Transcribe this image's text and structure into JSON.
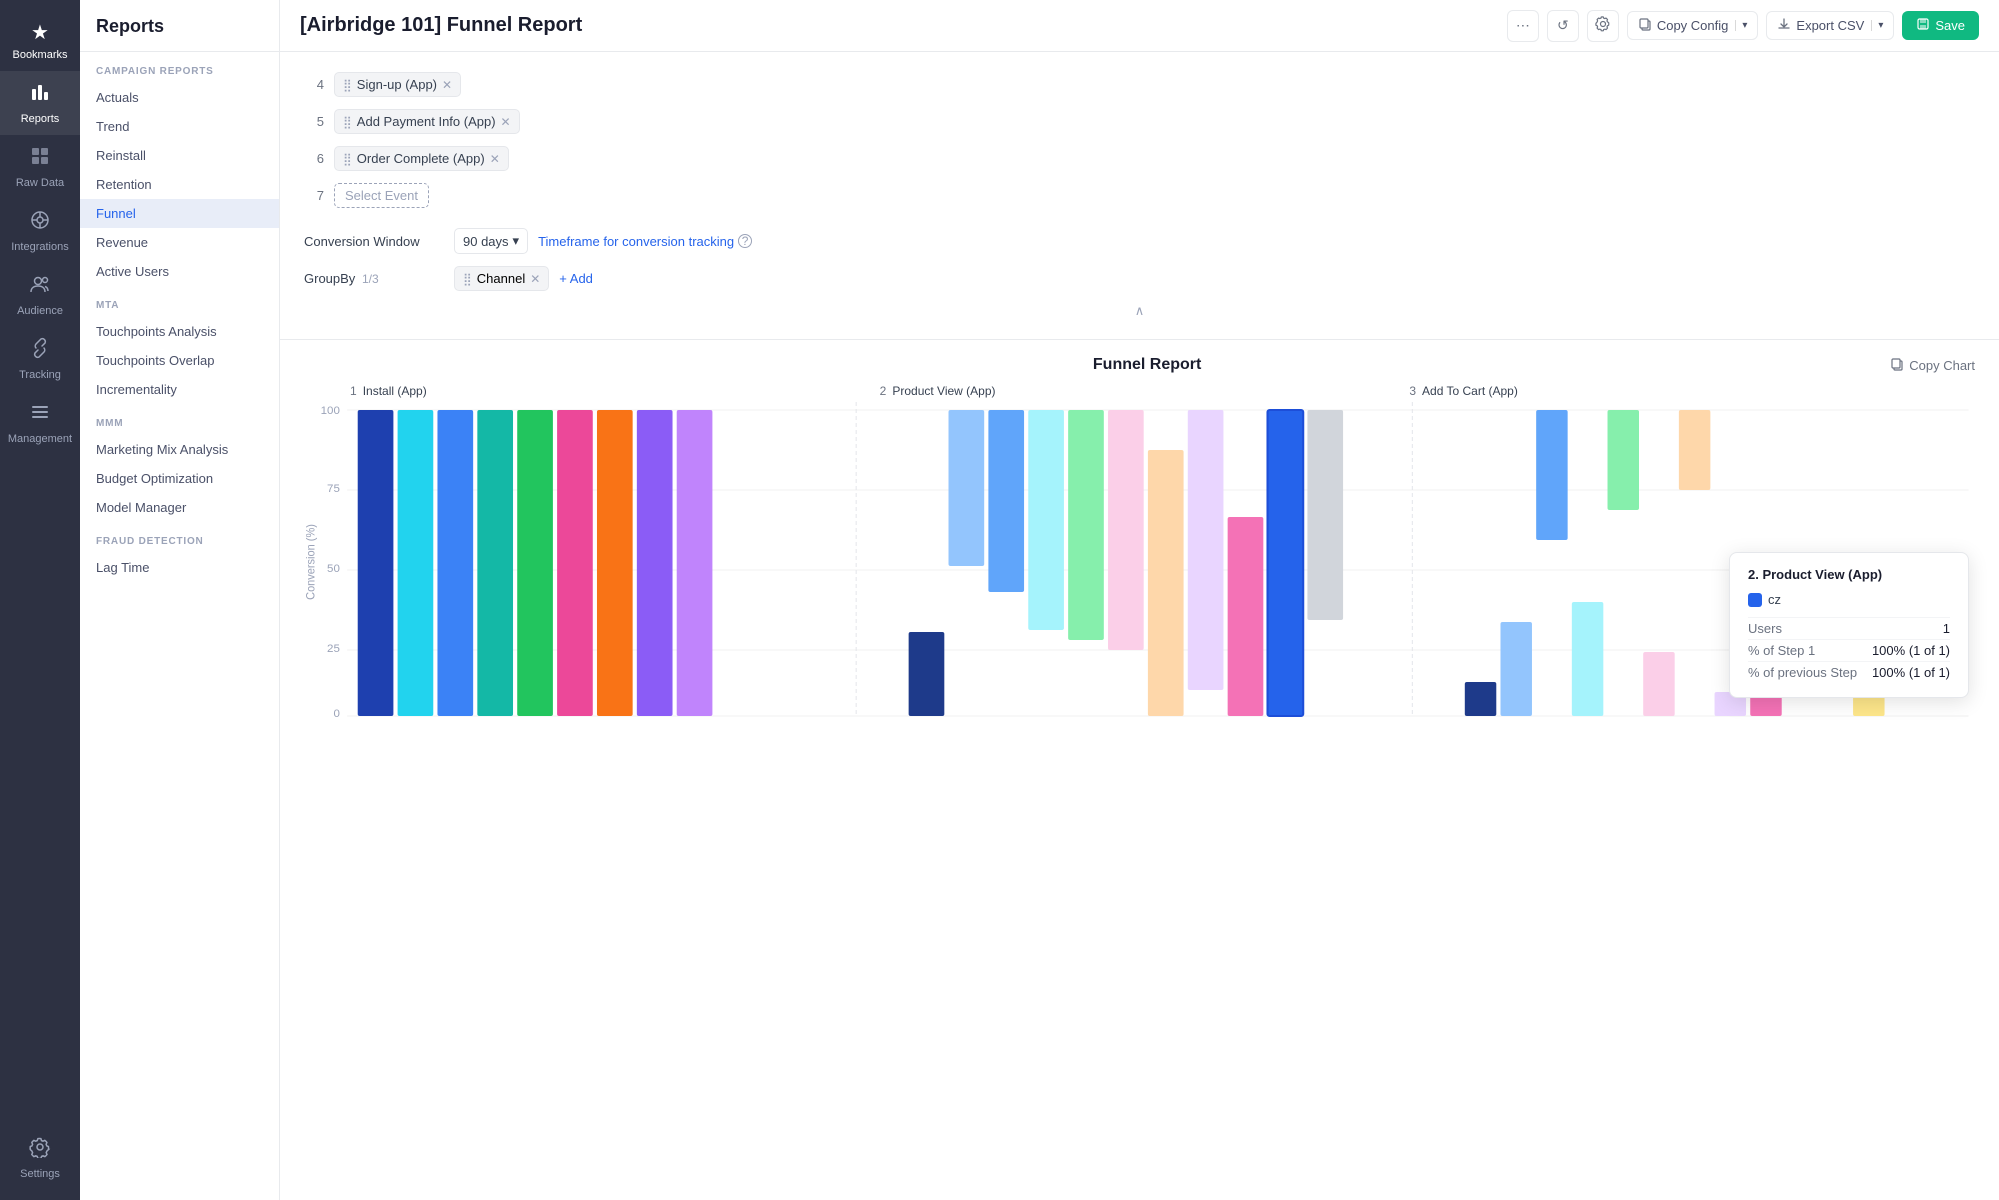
{
  "sidebar": {
    "items": [
      {
        "id": "bookmarks",
        "label": "Bookmarks",
        "icon": "★"
      },
      {
        "id": "reports",
        "label": "Reports",
        "icon": "📊"
      },
      {
        "id": "raw-data",
        "label": "Raw Data",
        "icon": "⊞"
      },
      {
        "id": "integrations",
        "label": "Integrations",
        "icon": "⊕"
      },
      {
        "id": "audience",
        "label": "Audience",
        "icon": "👥"
      },
      {
        "id": "tracking-link",
        "label": "Tracking Link",
        "icon": "🔗"
      },
      {
        "id": "management",
        "label": "Management",
        "icon": "⚙"
      },
      {
        "id": "settings",
        "label": "Settings",
        "icon": "⚙"
      }
    ]
  },
  "left_nav": {
    "title": "Reports",
    "sections": [
      {
        "label": "CAMPAIGN REPORTS",
        "items": [
          "Actuals",
          "Trend",
          "Reinstall",
          "Retention",
          "Funnel",
          "Revenue",
          "Active Users"
        ]
      },
      {
        "label": "MTA",
        "items": [
          "Touchpoints Analysis",
          "Touchpoints Overlap",
          "Incrementality"
        ]
      },
      {
        "label": "MMM",
        "items": [
          "Marketing Mix Analysis",
          "Budget Optimization",
          "Model Manager"
        ]
      },
      {
        "label": "FRAUD DETECTION",
        "items": [
          "Lag Time"
        ]
      }
    ]
  },
  "header": {
    "title": "[Airbridge 101] Funnel Report",
    "actions": {
      "more_label": "⋯",
      "refresh_label": "↺",
      "settings_label": "⚙",
      "copy_config_label": "Copy Config",
      "export_csv_label": "Export CSV",
      "save_label": "Save"
    }
  },
  "config": {
    "steps": [
      {
        "num": "4",
        "event": "Sign-up (App)",
        "show_close": true
      },
      {
        "num": "5",
        "event": "Add Payment Info (App)",
        "show_close": true
      },
      {
        "num": "6",
        "event": "Order Complete (App)",
        "show_close": true
      },
      {
        "num": "7",
        "event": null,
        "placeholder": "Select Event"
      }
    ],
    "conversion_window": {
      "label": "Conversion Window",
      "value": "90 days",
      "timeframe_link": "Timeframe for conversion tracking",
      "help_icon": "?"
    },
    "group_by": {
      "label": "GroupBy",
      "count": "1/3",
      "tags": [
        "Channel"
      ],
      "add_label": "+ Add"
    },
    "collapse_icon": "∧"
  },
  "chart": {
    "title": "Funnel Report",
    "copy_chart_label": "Copy Chart",
    "steps": [
      {
        "num": "1",
        "label": "Install (App)"
      },
      {
        "num": "2",
        "label": "Product View (App)"
      },
      {
        "num": "3",
        "label": "Add To Cart (App)"
      }
    ],
    "y_axis": {
      "label": "Conversion (%)",
      "values": [
        "100",
        "75",
        "50",
        "25",
        "0"
      ]
    },
    "tooltip": {
      "title": "2. Product View (App)",
      "legend_color": "#2563eb",
      "legend_label": "cz",
      "rows": [
        {
          "label": "Users",
          "value": "1"
        },
        {
          "label": "% of Step 1",
          "value": "100% (1 of 1)"
        },
        {
          "label": "% of previous Step",
          "value": "100% (1 of 1)"
        }
      ]
    }
  }
}
